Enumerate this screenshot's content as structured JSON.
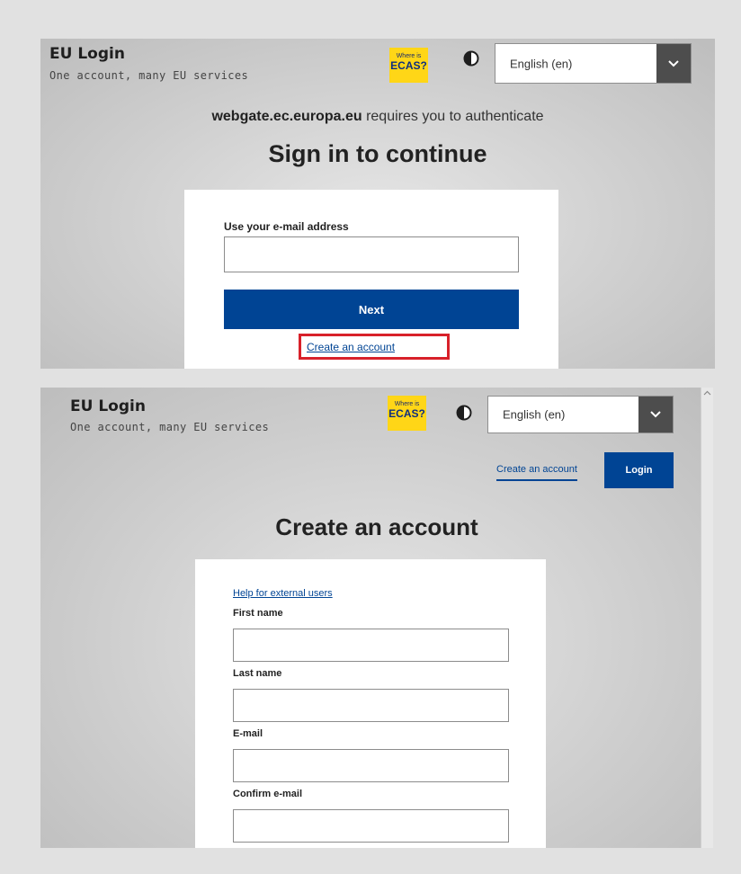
{
  "colors": {
    "primary": "#004494",
    "ecas_yellow": "#ffd617",
    "highlight_red": "#d8212a",
    "lang_arrow_bg": "#4d4d4d"
  },
  "screen1": {
    "brand_title": "EU Login",
    "brand_subtitle": "One account, many EU services",
    "ecas_small": "Where is",
    "ecas_big": "ECAS?",
    "contrast_icon": "contrast-icon",
    "language": "English (en)",
    "requires_domain": "webgate.ec.europa.eu",
    "requires_text": " requires you to authenticate",
    "heading": "Sign in to continue",
    "email_label": "Use your e-mail address",
    "email_value": "",
    "next_label": "Next",
    "create_account_link": "Create an account"
  },
  "screen2": {
    "brand_title": "EU Login",
    "brand_subtitle": "One account, many EU services",
    "ecas_small": "Where is",
    "ecas_big": "ECAS?",
    "contrast_icon": "contrast-icon",
    "language": "English (en)",
    "nav_create_account": "Create an account",
    "nav_login": "Login",
    "heading": "Create an account",
    "help_link": "Help for external users",
    "fields": {
      "first_name": {
        "label": "First name",
        "value": ""
      },
      "last_name": {
        "label": "Last name",
        "value": ""
      },
      "email": {
        "label": "E-mail",
        "value": ""
      },
      "confirm_email": {
        "label": "Confirm e-mail",
        "value": ""
      }
    }
  }
}
